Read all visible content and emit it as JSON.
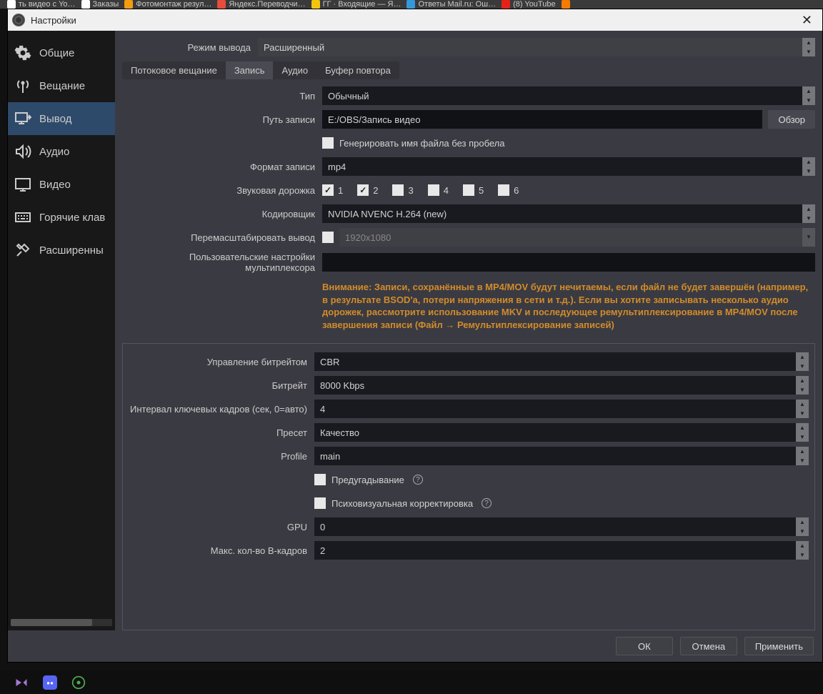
{
  "browser_tabs": [
    "ть видео с Yo…",
    "Заказы",
    "Фотомонтаж резул…",
    "Яндекс.Переводчи…",
    "ГГ · Входящие — Я…",
    "Ответы Mail.ru: Ош…",
    "(8) YouTube"
  ],
  "window_title": "Настройки",
  "sidebar": [
    "Общие",
    "Вещание",
    "Вывод",
    "Аудио",
    "Видео",
    "Горячие клав",
    "Расширенны"
  ],
  "mode": {
    "label": "Режим вывода",
    "value": "Расширенный"
  },
  "tabs": [
    "Потоковое вещание",
    "Запись",
    "Аудио",
    "Буфер повтора"
  ],
  "rec": {
    "type_label": "Тип",
    "type_value": "Обычный",
    "path_label": "Путь записи",
    "path_value": "E:/OBS/Запись видео",
    "browse": "Обзор",
    "gen_no_space": "Генерировать имя файла без пробела",
    "format_label": "Формат записи",
    "format_value": "mp4",
    "audio_track_label": "Звуковая дорожка",
    "tracks": [
      "1",
      "2",
      "3",
      "4",
      "5",
      "6"
    ],
    "encoder_label": "Кодировщик",
    "encoder_value": "NVIDIA NVENC H.264 (new)",
    "rescale_label": "Перемасштабировать вывод",
    "rescale_value": "1920x1080",
    "mux_label": "Пользовательские настройки мультиплексора",
    "warning": "Внимание: Записи, сохранённые в MP4/MOV будут нечитаемы, если файл не будет завершён (например, в результате BSOD'а, потери напряжения в сети и т.д.). Если вы хотите записывать несколько аудио дорожек, рассмотрите использование MKV и последующее ремультиплексирование в MP4/MOV после завершения записи (Файл → Ремультиплексирование записей)"
  },
  "enc": {
    "rate_control_label": "Управление битрейтом",
    "rate_control": "CBR",
    "bitrate_label": "Битрейт",
    "bitrate": "8000 Kbps",
    "keyint_label": "Интервал ключевых кадров (сек, 0=авто)",
    "keyint": "4",
    "preset_label": "Пресет",
    "preset": "Качество",
    "profile_label": "Profile",
    "profile": "main",
    "lookahead": "Предугадывание",
    "psycho": "Психовизуальная корректировка",
    "gpu_label": "GPU",
    "gpu": "0",
    "bframes_label": "Макс. кол-во B-кадров",
    "bframes": "2"
  },
  "footer": {
    "ok": "ОК",
    "cancel": "Отмена",
    "apply": "Применить"
  }
}
